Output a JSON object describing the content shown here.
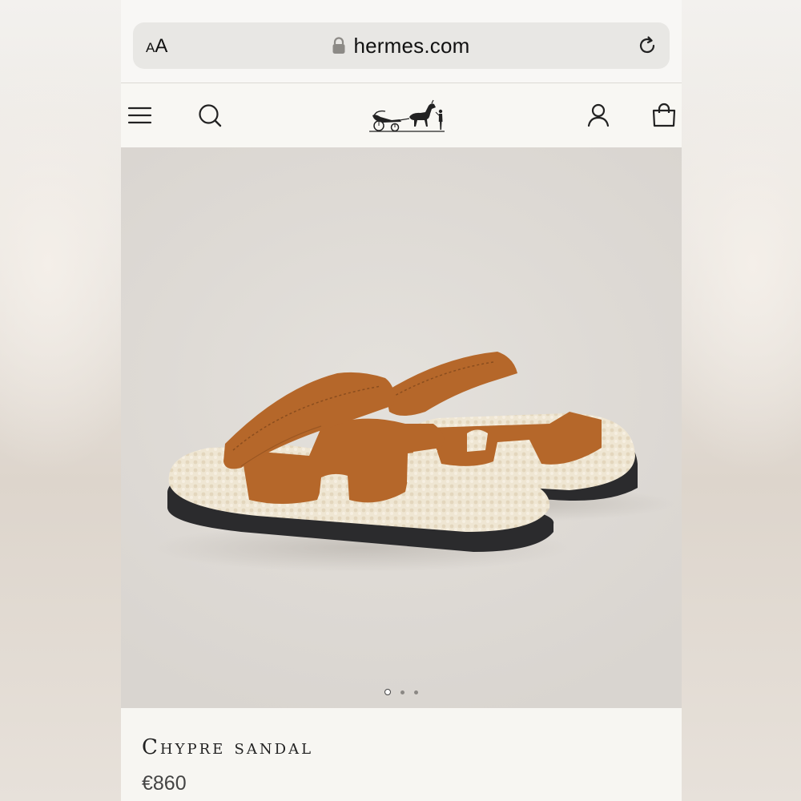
{
  "browser": {
    "text_size_button": "AA",
    "url": "hermes.com"
  },
  "header": {
    "icons": [
      "menu-icon",
      "search-icon",
      "hermes-logo",
      "account-icon",
      "shopping-bag-icon"
    ]
  },
  "product": {
    "name": "Chypre sandal",
    "price": "€860",
    "image_alt": "sandals",
    "carousel": {
      "count": 3,
      "active_index": 0
    }
  },
  "colors": {
    "leather": "#b5672a",
    "shearling": "#efe5d2",
    "sole": "#2b2b2d",
    "background": "#f7f6f2"
  }
}
